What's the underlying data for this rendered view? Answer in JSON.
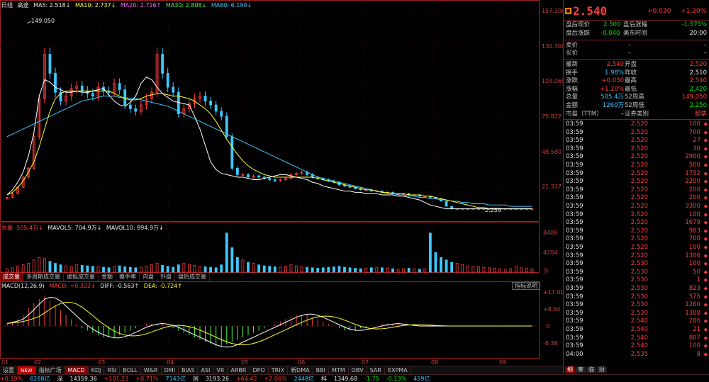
{
  "colors": {
    "up": "#ff3c3c",
    "down": "#3cc8ff",
    "ma5": "#ffffff",
    "ma10": "#ffff30",
    "ma20": "#ff60ff",
    "ma30": "#40ff40",
    "ma60": "#3cc8ff"
  },
  "kline_legend": {
    "period": "日线",
    "adjust": "高途",
    "ma5": "MA5: 2.518↓",
    "ma10": "MA10: 2.737↓",
    "ma20": "MA20: 2.716↑",
    "ma30": "MA30: 2.808↓",
    "ma60": "MA60: 6.190↓"
  },
  "price_axis": [
    "157.206",
    "130.308",
    "103.065",
    "75.822",
    "48.580",
    "21.337"
  ],
  "annotations": {
    "high": "149.050",
    "low": "2.250"
  },
  "volume_legend": {
    "total": "总量: 505.4万↓",
    "mavol5": "MAVOL5: 704.9万↓",
    "mavol10": "MAVOL10: 894.9万↓"
  },
  "volume_axis": [
    "8409",
    "4204",
    "万"
  ],
  "volume_tabs": [
    "成交量",
    "多周期成交量",
    "虚拟成交量",
    "金额",
    "换手率",
    "内盘",
    "外盘",
    "盘后成交量"
  ],
  "macd_legend": {
    "name": "MACD(12,26,9)",
    "macd": "MACD: +0.322↓",
    "diff": "DIFF: -0.563↑",
    "dea": "DEA: -0.724↑"
  },
  "macd_help": "指标说明",
  "macd_axis": [
    "+17.00",
    "+8.54",
    "0",
    "-8.38"
  ],
  "x_axis": [
    "01",
    "02",
    "03",
    "04",
    "05",
    "06",
    "07",
    "08",
    "09"
  ],
  "indicator_tabs": [
    "设置",
    "NEW",
    "指标广场",
    "MACD",
    "KDJ",
    "RSI",
    "BOLL",
    "W&R",
    "DMI",
    "BIAS",
    "ASI",
    "VR",
    "ARBR",
    "DPO",
    "TRIX",
    "新DMA",
    "BBI",
    "MTM",
    "OBV",
    "SAR",
    "EXPMA"
  ],
  "quote": {
    "price": "2.540",
    "change": "+0.030",
    "pct": "+1.20%",
    "after_rows": [
      {
        "k1": "盘后现价",
        "v1": "2.500",
        "k2": "盘后涨幅",
        "v2": "-1.575%"
      },
      {
        "k1": "盘后涨跌",
        "v1": "-0.040",
        "k2": "美东时间",
        "v2": "20:00"
      }
    ],
    "sell": {
      "k": "卖价",
      "v": "–",
      "v2": "–"
    },
    "buy": {
      "k": "买价",
      "v": "–",
      "v2": "–"
    },
    "stats": [
      {
        "k1": "最新",
        "v1": "2.540",
        "k2": "开盘",
        "v2": "2.520"
      },
      {
        "k1": "换手",
        "v1": "1.98%",
        "k2": "昨收",
        "v2": "2.510"
      },
      {
        "k1": "涨跌",
        "v1": "+0.030",
        "k2": "最高",
        "v2": "2.540"
      },
      {
        "k1": "涨幅",
        "v1": "+1.20%",
        "k2": "最低",
        "v2": "2.420"
      },
      {
        "k1": "总量",
        "v1": "505.4万",
        "k2": "52周高",
        "v2": "149.050"
      },
      {
        "k1": "金额",
        "v1": "1260万",
        "k2": "52周低",
        "v2": "2.250"
      },
      {
        "k1": "市盈（TTM）",
        "v1": "–",
        "k2": "证券类别",
        "v2": "股票"
      }
    ]
  },
  "ticks": [
    {
      "t": "03:59",
      "p": "2.520",
      "v": "100"
    },
    {
      "t": "03:59",
      "p": "2.520",
      "v": "700"
    },
    {
      "t": "03:59",
      "p": "2.520",
      "v": "27"
    },
    {
      "t": "03:59",
      "p": "2.520",
      "v": "30"
    },
    {
      "t": "03:59",
      "p": "2.520",
      "v": "2900"
    },
    {
      "t": "03:59",
      "p": "2.520",
      "v": "500"
    },
    {
      "t": "03:59",
      "p": "2.520",
      "v": "1752"
    },
    {
      "t": "03:59",
      "p": "2.520",
      "v": "2200"
    },
    {
      "t": "03:59",
      "p": "2.520",
      "v": "200"
    },
    {
      "t": "03:59",
      "p": "2.520",
      "v": "200"
    },
    {
      "t": "03:59",
      "p": "2.520",
      "v": "3300"
    },
    {
      "t": "03:59",
      "p": "2.520",
      "v": "100"
    },
    {
      "t": "03:59",
      "p": "2.520",
      "v": "1679"
    },
    {
      "t": "03:59",
      "p": "2.520",
      "v": "983"
    },
    {
      "t": "03:59",
      "p": "2.520",
      "v": "700"
    },
    {
      "t": "03:59",
      "p": "2.520",
      "v": "100"
    },
    {
      "t": "03:59",
      "p": "2.520",
      "v": "1306"
    },
    {
      "t": "03:59",
      "p": "2.530",
      "v": "100"
    },
    {
      "t": "03:59",
      "p": "2.530",
      "v": "50"
    },
    {
      "t": "03:59",
      "p": "2.530",
      "v": "1"
    },
    {
      "t": "03:59",
      "p": "2.530",
      "v": "823"
    },
    {
      "t": "03:59",
      "p": "2.530",
      "v": "575"
    },
    {
      "t": "03:59",
      "p": "2.530",
      "v": "1260"
    },
    {
      "t": "03:59",
      "p": "2.530",
      "v": "1308"
    },
    {
      "t": "03:59",
      "p": "2.540",
      "v": "286"
    },
    {
      "t": "03:59",
      "p": "2.540",
      "v": "21"
    },
    {
      "t": "03:59",
      "p": "2.540",
      "v": "807"
    },
    {
      "t": "03:59",
      "p": "2.540",
      "v": "100"
    },
    {
      "t": "04:00",
      "p": "2.535",
      "v": "8"
    }
  ],
  "right_tabs": [
    "细",
    "筹",
    "临",
    "财"
  ],
  "ticker": [
    {
      "v": "+0.19%",
      "c": "red"
    },
    {
      "v": "6288亿",
      "c": "cyan"
    },
    {
      "v": "深",
      "c": "white"
    },
    {
      "v": "14359.36",
      "c": "white"
    },
    {
      "v": "+101.23",
      "c": "red"
    },
    {
      "v": "+0.71%",
      "c": "red"
    },
    {
      "v": "7143亿",
      "c": "cyan"
    },
    {
      "v": "创",
      "c": "white"
    },
    {
      "v": "3193.26",
      "c": "white"
    },
    {
      "v": "+64.42",
      "c": "red"
    },
    {
      "v": "+2.06%",
      "c": "red"
    },
    {
      "v": "2448亿",
      "c": "cyan"
    },
    {
      "v": "科",
      "c": "white"
    },
    {
      "v": "1349.68",
      "c": "white"
    },
    {
      "v": "-1.75",
      "c": "green"
    },
    {
      "v": "-0.13%",
      "c": "green"
    },
    {
      "v": "459亿",
      "c": "cyan"
    }
  ],
  "chart_data": {
    "type": "candlestick",
    "close": [
      12,
      15,
      20,
      28,
      35,
      60,
      90,
      125,
      110,
      95,
      88,
      92,
      98,
      100,
      96,
      94,
      92,
      99,
      96,
      95,
      102,
      97,
      85,
      82,
      80,
      85,
      90,
      95,
      125,
      110,
      99,
      95,
      78,
      82,
      86,
      90,
      92,
      88,
      85,
      80,
      76,
      60,
      35,
      30,
      30,
      28,
      29,
      28,
      27,
      26,
      25,
      26,
      27,
      30,
      31,
      32,
      30,
      28,
      27,
      26,
      25,
      24,
      22,
      21,
      20,
      19,
      18,
      18,
      17,
      17,
      16,
      16,
      15,
      15,
      15,
      14,
      14,
      13,
      13,
      12,
      11,
      9,
      5,
      3,
      3,
      3,
      3,
      3,
      3,
      3,
      3,
      3,
      3,
      3,
      3,
      3,
      3,
      3,
      3
    ],
    "ma5": [
      14,
      18,
      24,
      32,
      45,
      63,
      92,
      105,
      103,
      99,
      97,
      95,
      95,
      96,
      95,
      95,
      96,
      97,
      98,
      93,
      88,
      85,
      84,
      87,
      92,
      102,
      107,
      105,
      99,
      94,
      91,
      88,
      87,
      86,
      85,
      76,
      66,
      53,
      40,
      34,
      31,
      30,
      29,
      28,
      28,
      27,
      26,
      26,
      27,
      28,
      29,
      30,
      30,
      29,
      28,
      27,
      26,
      24,
      23,
      21,
      20,
      19,
      18,
      17,
      17,
      16,
      16,
      15,
      15,
      15,
      14,
      14,
      14,
      13,
      13,
      12,
      11,
      10,
      8,
      6,
      5,
      4,
      3,
      3,
      3,
      3,
      3,
      3,
      3,
      3,
      3,
      3,
      3,
      3,
      3,
      3,
      3,
      3,
      3
    ],
    "ma10": [
      14,
      16,
      20,
      25,
      32,
      40,
      52,
      66,
      80,
      90,
      94,
      96,
      96,
      96,
      96,
      96,
      96,
      96,
      96,
      96,
      94,
      92,
      90,
      89,
      89,
      90,
      92,
      93,
      94,
      94,
      93,
      92,
      92,
      91,
      90,
      88,
      85,
      82,
      78,
      72,
      65,
      58,
      52,
      46,
      41,
      37,
      34,
      32,
      30,
      29,
      28,
      28,
      28,
      28,
      28,
      28,
      28,
      28,
      27,
      26,
      25,
      24,
      23,
      22,
      21,
      20,
      19,
      18,
      18,
      17,
      16,
      16,
      15,
      15,
      15,
      14,
      14,
      14,
      13,
      13,
      12,
      11,
      10,
      9,
      8,
      7,
      6,
      5,
      4,
      4,
      3,
      3,
      3,
      3,
      3,
      3,
      3,
      3,
      3
    ],
    "ma60": [
      60,
      62,
      64,
      66,
      68,
      70,
      72,
      74,
      76,
      78,
      80,
      82,
      84,
      86,
      88,
      89,
      90,
      91,
      92,
      92,
      92,
      91,
      91,
      90,
      90,
      89,
      88,
      87,
      86,
      85,
      84,
      82,
      80,
      78,
      76,
      74,
      72,
      70,
      68,
      66,
      64,
      62,
      60,
      58,
      56,
      54,
      52,
      50,
      48,
      46,
      44,
      42,
      40,
      38,
      36,
      34,
      32,
      30,
      28,
      27,
      26,
      25,
      24,
      23,
      22,
      21,
      20,
      19,
      18,
      17,
      16,
      15,
      15,
      14,
      14,
      13,
      13,
      12,
      12,
      11,
      11,
      10,
      10,
      9,
      9,
      8,
      8,
      7,
      7,
      7,
      6,
      6,
      6,
      6,
      5,
      5,
      5,
      5,
      5
    ],
    "volume": [
      700,
      900,
      1200,
      1500,
      1800,
      2500,
      3000,
      2800,
      2200,
      1800,
      1500,
      1300,
      1200,
      1600,
      1400,
      1300,
      1200,
      1100,
      1000,
      900,
      1200,
      1300,
      1100,
      1000,
      900,
      1000,
      1200,
      1500,
      1800,
      1400,
      1200,
      1000,
      1500,
      1800,
      1600,
      1400,
      1200,
      1100,
      1000,
      900,
      1500,
      8000,
      5000,
      3000,
      2500,
      2000,
      1800,
      1500,
      1300,
      1200,
      1100,
      1000,
      1200,
      1500,
      1300,
      1100,
      1000,
      900,
      800,
      900,
      1000,
      1100,
      1200,
      1000,
      900,
      800,
      700,
      800,
      900,
      1000,
      900,
      800,
      700,
      600,
      700,
      800,
      700,
      600,
      700,
      8000,
      4000,
      3000,
      2500,
      2000,
      1800,
      1500,
      1300,
      1200,
      1100,
      1000,
      900,
      800,
      700,
      600,
      700,
      1200,
      900,
      800,
      600
    ],
    "macd": [
      1,
      2,
      3,
      5,
      8,
      10,
      12,
      13,
      11,
      9,
      7,
      5,
      3,
      1,
      -1,
      -2,
      -3,
      -4,
      -5,
      -5,
      -5,
      -4,
      -3,
      -2,
      -1,
      0,
      1,
      1,
      1,
      1,
      0,
      -1,
      -2,
      -3,
      -4,
      -5,
      -6,
      -7,
      -8,
      -9,
      -9,
      -8,
      -7,
      -6,
      -5,
      -4,
      -3,
      -2,
      -1,
      0,
      1,
      2,
      3,
      4,
      5,
      5,
      5,
      4,
      3,
      2,
      1,
      0,
      -1,
      -2,
      -2,
      -2,
      -1,
      -1,
      0,
      0,
      1,
      1,
      1,
      1,
      0,
      0,
      0,
      0,
      0,
      0,
      0,
      0,
      0,
      0,
      0,
      0,
      0,
      0,
      0,
      0,
      0,
      0,
      0,
      0,
      0,
      0,
      0,
      0,
      0
    ]
  }
}
